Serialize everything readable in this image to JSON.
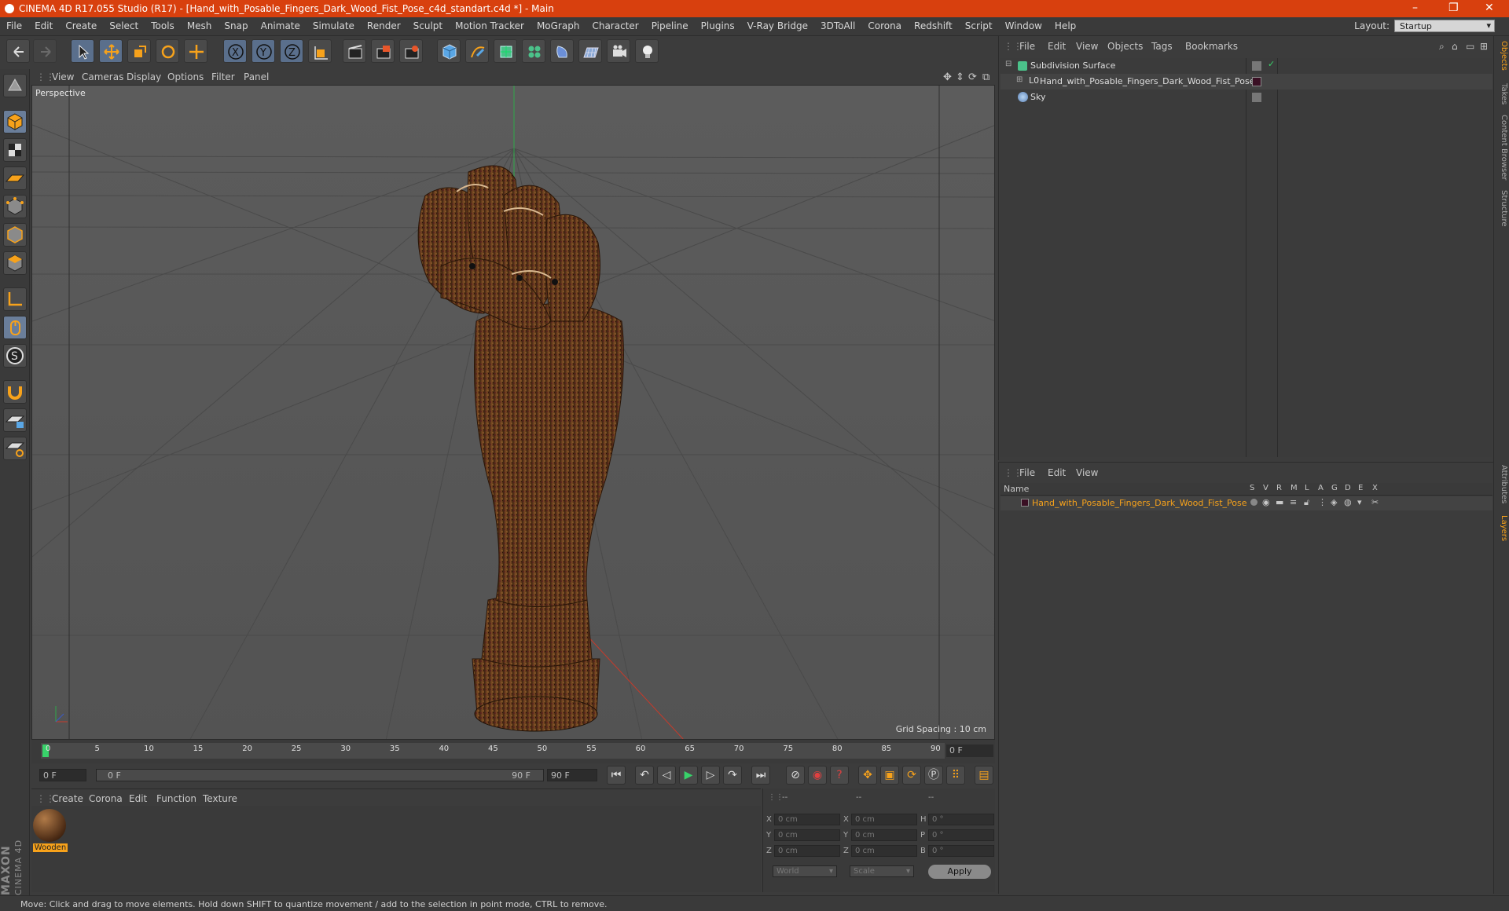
{
  "titlebar": {
    "title": "CINEMA 4D R17.055 Studio (R17) - [Hand_with_Posable_Fingers_Dark_Wood_Fist_Pose_c4d_standart.c4d *] - Main",
    "min": "–",
    "max": "❐",
    "close": "✕"
  },
  "menubar": {
    "items": [
      "File",
      "Edit",
      "Create",
      "Select",
      "Tools",
      "Mesh",
      "Snap",
      "Animate",
      "Simulate",
      "Render",
      "Sculpt",
      "Motion Tracker",
      "MoGraph",
      "Character",
      "Pipeline",
      "Plugins",
      "V-Ray Bridge",
      "3DToAll",
      "Corona",
      "Redshift",
      "Script",
      "Window",
      "Help"
    ],
    "layout_label": "Layout:",
    "layout_value": "Startup"
  },
  "toolbar": {
    "axis": [
      "X",
      "Y",
      "Z"
    ]
  },
  "viewport": {
    "menu": [
      "View",
      "Cameras",
      "Display",
      "Options",
      "Filter",
      "Panel"
    ],
    "label": "Perspective",
    "grid_spacing": "Grid Spacing : 10 cm"
  },
  "timeline": {
    "ticks": [
      "0",
      "5",
      "10",
      "15",
      "20",
      "25",
      "30",
      "35",
      "40",
      "45",
      "50",
      "55",
      "60",
      "65",
      "70",
      "75",
      "80",
      "85",
      "90"
    ],
    "current_frame": "0 F"
  },
  "transport": {
    "start": "0 F",
    "range_start": "0 F",
    "range_end": "90 F",
    "end": "90 F"
  },
  "material_manager": {
    "menu": [
      "Create",
      "Corona",
      "Edit",
      "Function",
      "Texture"
    ],
    "materials": [
      {
        "name": "Wooden"
      }
    ]
  },
  "coordinates": {
    "headers": [
      "--",
      "--",
      "--"
    ],
    "rows": [
      {
        "a": "X",
        "av": "0 cm",
        "b": "X",
        "bv": "0 cm",
        "c": "H",
        "cv": "0 °"
      },
      {
        "a": "Y",
        "av": "0 cm",
        "b": "Y",
        "bv": "0 cm",
        "c": "P",
        "cv": "0 °"
      },
      {
        "a": "Z",
        "av": "0 cm",
        "b": "Z",
        "bv": "0 cm",
        "c": "B",
        "cv": "0 °"
      }
    ],
    "space": "World",
    "mode": "Scale",
    "apply": "Apply"
  },
  "object_manager": {
    "menu": [
      "File",
      "Edit",
      "View",
      "Objects",
      "Tags",
      "Bookmarks"
    ],
    "objects": [
      {
        "name": "Subdivision Surface"
      },
      {
        "name": "Hand_with_Posable_Fingers_Dark_Wood_Fist_Pose"
      },
      {
        "name": "Sky"
      }
    ]
  },
  "layer_manager": {
    "menu": [
      "File",
      "Edit",
      "View"
    ],
    "header_name": "Name",
    "columns": [
      "S",
      "V",
      "R",
      "M",
      "L",
      "A",
      "G",
      "D",
      "E",
      "X"
    ],
    "layers": [
      {
        "name": "Hand_with_Posable_Fingers_Dark_Wood_Fist_Pose"
      }
    ]
  },
  "right_tabs": [
    "Objects",
    "Takes",
    "Content Browser",
    "Structure",
    "Attributes",
    "Layers"
  ],
  "maxon_logo": {
    "line1": "MAXON",
    "line2": "CINEMA 4D"
  },
  "status": "Move: Click and drag to move elements. Hold down SHIFT to quantize movement / add to the selection in point mode, CTRL to remove.",
  "colors": {
    "titlebar": "#d8400e",
    "accent": "#f7a21b",
    "selected_tool": "#5a6f8c"
  }
}
